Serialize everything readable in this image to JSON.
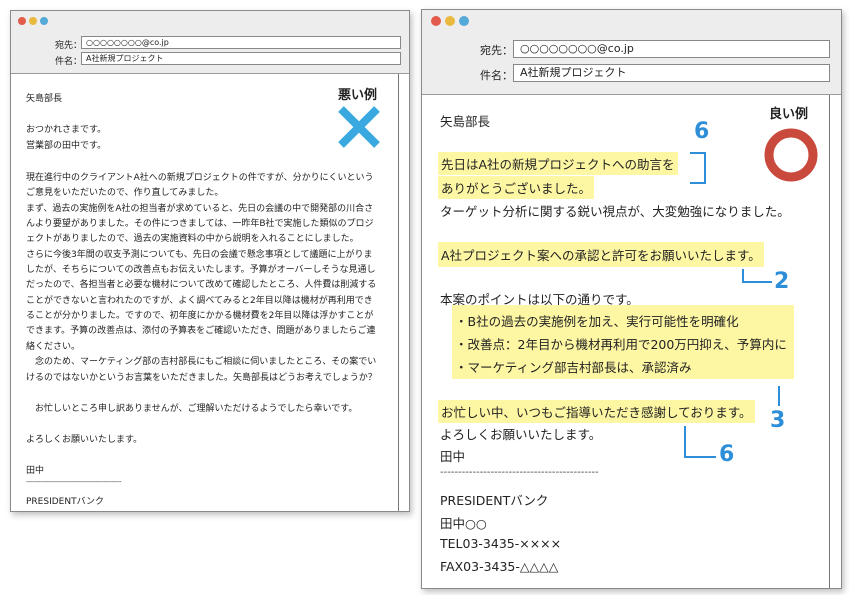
{
  "bad": {
    "fields": {
      "to_label": "宛先：",
      "to_value": "○○○○○○○○@co.jp",
      "subject_label": "件名：",
      "subject_value": "A社新規プロジェクト"
    },
    "badge": {
      "label": "悪い例",
      "mark": "✕",
      "mark_color": "#39a9e0"
    },
    "lines": [
      "矢島部長",
      "おつかれさまです。",
      "営業部の田中です。",
      "現在進行中のクライアントA社への新規プロジェクトの件ですが、分かりにくいという",
      "ご意見をいただいたので、作り直してみました。",
      "まず、過去の実施例をA社の担当者が求めていると、先日の会議の中で開発部の川合さ",
      "んより要望がありました。その件につきましては、一昨年B社で実施した類似のプロジ",
      "ェクトがありましたので、過去の実施資料の中から説明を入れることにしました。",
      "さらに今後3年間の収支予測についても、先日の会議で懸念事項として議題に上がりま",
      "したが、そちらについての改善点もお伝えいたします。予算がオーバーしそうな見通し",
      "だったので、各担当者と必要な機材について改めて確認したところ、人件費は削減する",
      "ことができないと言われたのですが、よく調べてみると2年目以降は機材が再利用でき",
      "ることが分かりました。ですので、初年度にかかる機材費を2年目以降は浮かすことが",
      "できます。予算の改善点は、添付の予算表をご確認いただき、問題がありましたらご連",
      "絡ください。",
      "　念のため、マーケティング部の吉村部長にもご相談に伺いましたところ、その案でい",
      "けるのではないかというお言葉をいただきました。矢島部長はどうお考えでしょうか？",
      "　お忙しいところ申し訳ありませんが、ご理解いただけるようでしたら幸いです。",
      "よろしくお願いいたします。",
      "田中",
      "-----------------------------------------------",
      "PRESIDENTバンク"
    ]
  },
  "good": {
    "fields": {
      "to_label": "宛先：",
      "to_value": "○○○○○○○○@co.jp",
      "subject_label": "件名：",
      "subject_value": "A社新規プロジェクト"
    },
    "badge": {
      "label": "良い例",
      "mark_color": "#c9493d"
    },
    "lines": [
      "矢島部長",
      "先日はA社の新規プロジェクトへの助言を",
      "ありがとうございました。",
      "ターゲット分析に関する鋭い視点が、大変勉強になりました。",
      "A社プロジェクト案への承認と許可をお願いいたします。",
      "本案のポイントは以下の通りです。",
      "・B社の過去の実施例を加え、実行可能性を明確化",
      "・改善点：2年目から機材再利用で200万円抑え、予算内に",
      "・マーケティング部吉村部長は、承認済み",
      "お忙しい中、いつもご指導いただき感謝しております。",
      "よろしくお願いいたします。",
      "田中",
      "--------------------------------------------",
      "PRESIDENTバンク",
      "田中○○",
      "TEL03-3435-××××",
      "FAX03-3435-△△△△"
    ],
    "annotations": [
      "6",
      "2",
      "3",
      "6"
    ],
    "accent_color": "#2e8fd8",
    "highlight_color": "#fdf6a3"
  }
}
